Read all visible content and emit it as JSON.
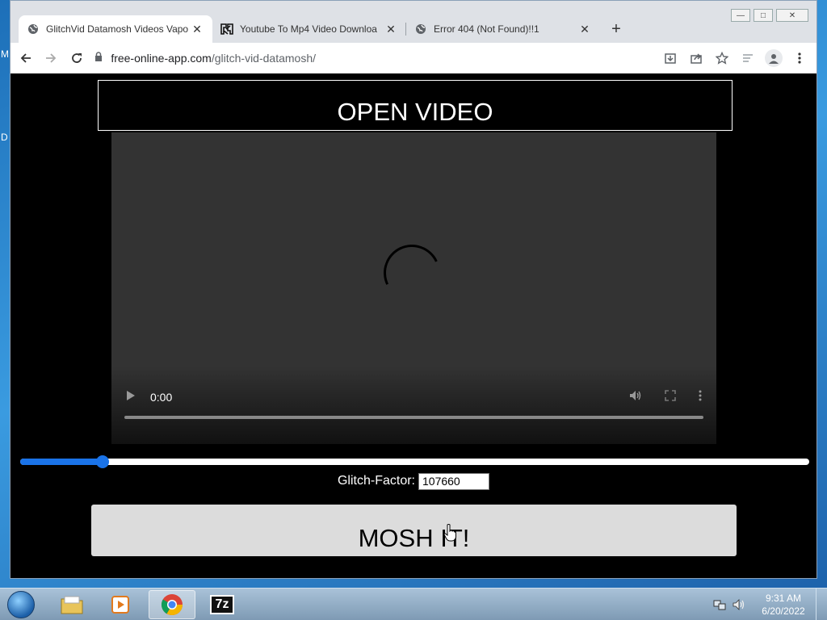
{
  "desktop": {
    "left_letter_1": "M",
    "left_letter_2": "D"
  },
  "window_controls": {
    "minimize": "—",
    "maximize": "□",
    "close": "✕"
  },
  "tabs": [
    {
      "title": "GlitchVid Datamosh Videos Vapo",
      "icon": "globe-icon",
      "close": "✕"
    },
    {
      "title": "Youtube To Mp4 Video Downloa",
      "icon": "site-logo-icon",
      "close": "✕"
    },
    {
      "title": "Error 404 (Not Found)!!1",
      "icon": "globe-icon",
      "close": "✕"
    }
  ],
  "new_tab": "+",
  "address": {
    "domain": "free-online-app.com",
    "path": "/glitch-vid-datamosh/"
  },
  "page": {
    "open_video_label": "OPEN VIDEO",
    "video_time": "0:00",
    "glitch_label": "Glitch-Factor:",
    "glitch_value": "107660",
    "slider_value": 0.104,
    "mosh_label": "MOSH IT!"
  },
  "taskbar": {
    "apps": [
      "explorer-icon",
      "media-player-icon",
      "chrome-icon",
      "7zip-icon"
    ],
    "sevenzip_text": "7z",
    "time": "9:31 AM",
    "date": "6/20/2022"
  },
  "colors": {
    "accent": "#1a73e8",
    "page_bg": "#000000",
    "video_bg": "#333333"
  }
}
